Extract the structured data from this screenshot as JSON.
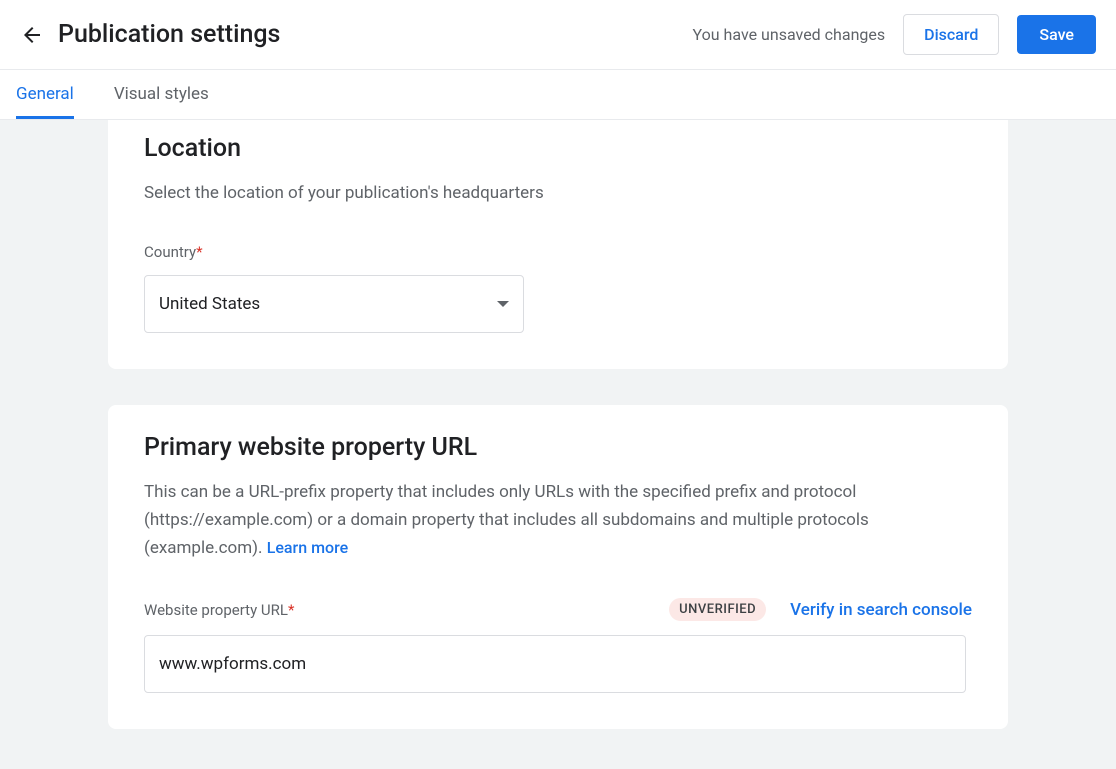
{
  "header": {
    "title": "Publication settings",
    "unsaved_message": "You have unsaved changes",
    "discard_label": "Discard",
    "save_label": "Save"
  },
  "tabs": {
    "general": "General",
    "visual_styles": "Visual styles"
  },
  "location": {
    "title": "Location",
    "description": "Select the location of your publication's headquarters",
    "country_label": "Country",
    "country_value": "United States"
  },
  "property": {
    "title": "Primary website property URL",
    "description": "This can be a URL-prefix property that includes only URLs with the specified prefix and protocol (https://example.com) or a domain property that includes all subdomains and multiple protocols (example.com). ",
    "learn_more": "Learn more",
    "url_label": "Website property URL",
    "badge": "UNVERIFIED",
    "verify_link": "Verify in search console",
    "url_value": "www.wpforms.com"
  }
}
